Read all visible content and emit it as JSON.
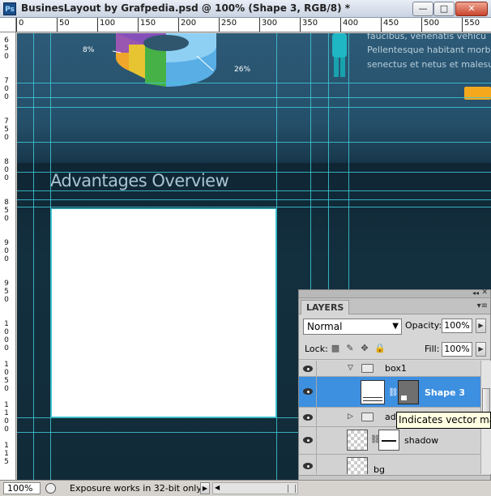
{
  "window": {
    "title": "BusinesLayout by Grafpedia.psd @ 100% (Shape 3, RGB/8) *",
    "app_icon": "Ps",
    "minimize": "—",
    "maximize": "□",
    "close": "✕"
  },
  "rulers": {
    "top": [
      "0",
      "50",
      "100",
      "150",
      "200",
      "250",
      "300",
      "350",
      "400",
      "450",
      "500",
      "550"
    ],
    "left": [
      [
        "6",
        "5",
        "0"
      ],
      [
        "7",
        "0",
        "0"
      ],
      [
        "7",
        "5",
        "0"
      ],
      [
        "8",
        "0",
        "0"
      ],
      [
        "8",
        "5",
        "0"
      ],
      [
        "9",
        "0",
        "0"
      ],
      [
        "9",
        "5",
        "0"
      ],
      [
        "1",
        "0",
        "0",
        "0"
      ],
      [
        "1",
        "0",
        "5",
        "0"
      ],
      [
        "1",
        "1",
        "0",
        "0"
      ],
      [
        "1",
        "1",
        "5"
      ]
    ]
  },
  "canvas": {
    "heading": "Advantages Overview",
    "pie_labels": [
      "8%",
      "26%"
    ],
    "side_text": [
      "faucibus, venenatis vehicu",
      "Pellentesque habitant morbi",
      "senectus et netus et malesu"
    ]
  },
  "layers_panel": {
    "tab": "LAYERS",
    "blend_mode": "Normal",
    "opacity_label": "Opacity:",
    "opacity_value": "100%",
    "lock_label": "Lock:",
    "fill_label": "Fill:",
    "fill_value": "100%",
    "layers": [
      {
        "name": "box1",
        "type": "group",
        "expanded": true
      },
      {
        "name": "Shape 3",
        "type": "shape",
        "selected": true
      },
      {
        "name": "adv",
        "type": "group",
        "expanded": false
      },
      {
        "name": "shadow",
        "type": "layer"
      },
      {
        "name": "bg",
        "type": "layer"
      }
    ],
    "bottom_icons": [
      "link-icon",
      "fx-icon",
      "mask-icon",
      "adjustment-icon",
      "folder-icon",
      "new-layer-icon",
      "trash-icon"
    ]
  },
  "tooltip": "Indicates vector mask",
  "status_bar": {
    "zoom": "100%",
    "text": "Exposure works in 32-bit only"
  }
}
